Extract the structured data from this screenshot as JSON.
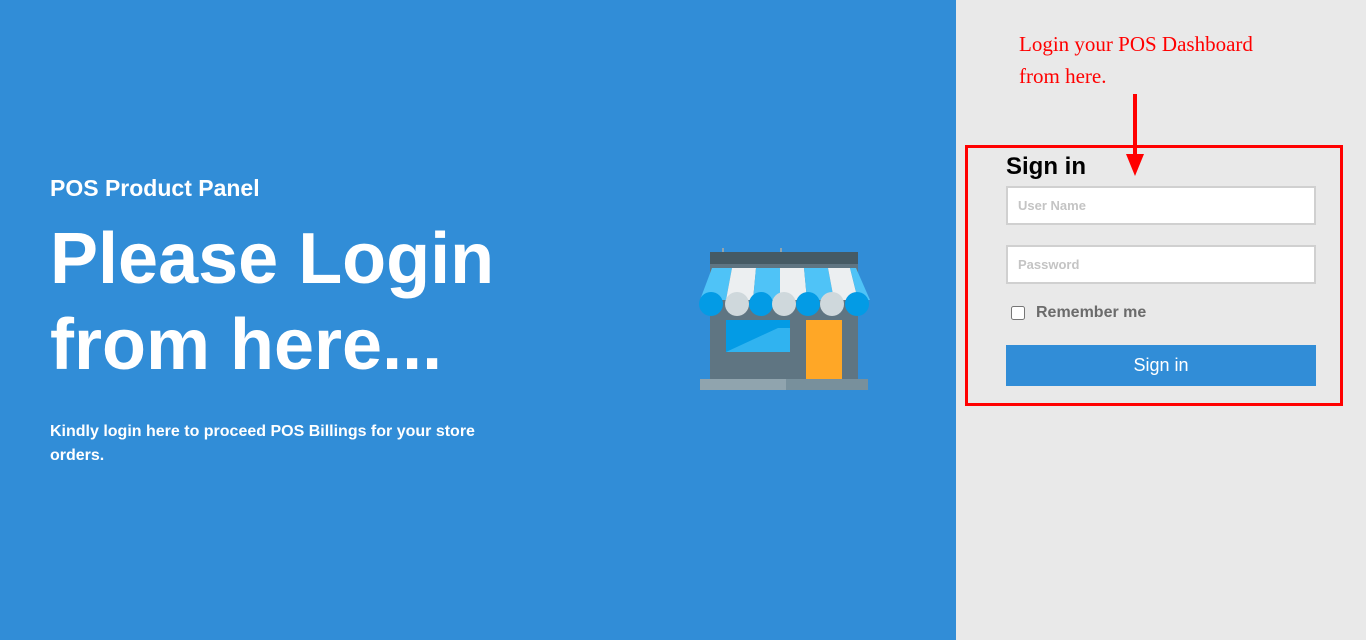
{
  "hero": {
    "kicker": "POS Product Panel",
    "headline_line1": "Please Login",
    "headline_line2": "from here...",
    "subtext": "Kindly login here to proceed POS Billings for your store orders.",
    "illustration_icon": "store-icon"
  },
  "annotation": {
    "text_line1": "Login your POS Dashboard",
    "text_line2": "from here.",
    "color": "#ff0000",
    "icon": "arrow-down-icon"
  },
  "login_form": {
    "title": "Sign in",
    "username_placeholder": "User Name",
    "username_value": "",
    "password_placeholder": "Password",
    "password_value": "",
    "remember_label": "Remember me",
    "remember_checked": false,
    "submit_label": "Sign in"
  },
  "colors": {
    "brand_blue": "#318dd7",
    "right_panel_bg": "#e9e9e9",
    "annotation_red": "#ff0000"
  }
}
